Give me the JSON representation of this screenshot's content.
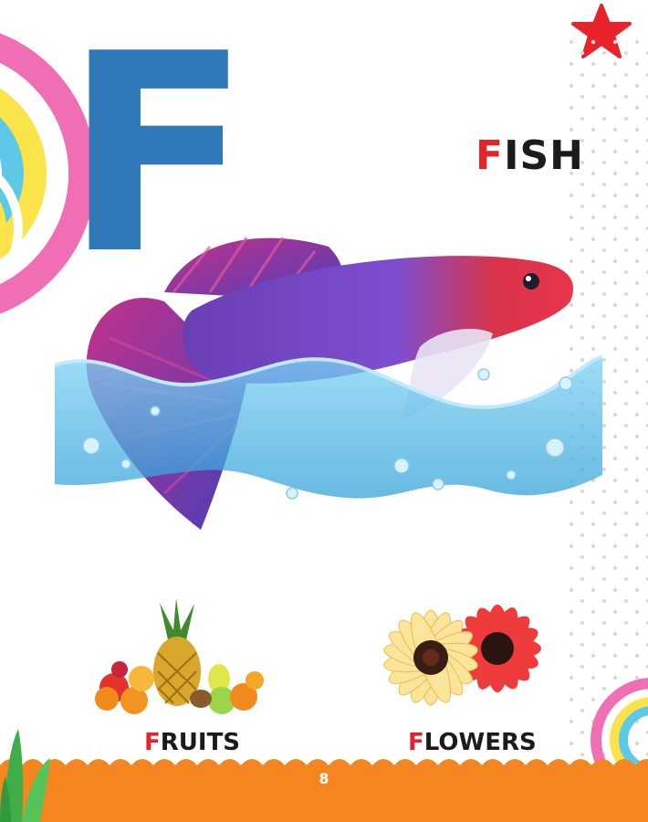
{
  "letter": "F",
  "main_word": {
    "first_letter": "F",
    "rest": "ISH"
  },
  "items": [
    {
      "first_letter": "F",
      "rest": "RUITS"
    },
    {
      "first_letter": "F",
      "rest": "LOWERS"
    }
  ],
  "page_number": "8",
  "colors": {
    "letter": "#2f79b9",
    "accent": "#e4232a",
    "footer": "#f5861f",
    "star": "#e8242b"
  },
  "icons": [
    "rainbow-icon",
    "star-icon",
    "fish-image",
    "fruits-image",
    "flowers-image",
    "grass-icon"
  ]
}
